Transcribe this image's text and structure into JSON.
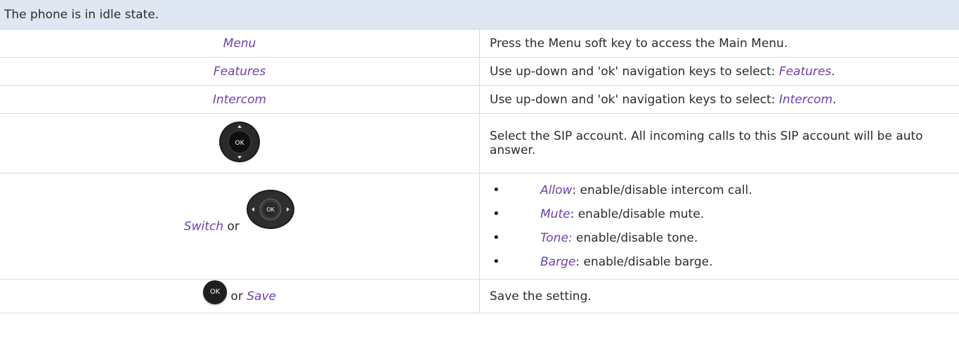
{
  "header": {
    "text": "The phone is in idle state."
  },
  "rows": [
    {
      "left": "Menu",
      "right": "Press the Menu soft key to access the Main Menu."
    },
    {
      "left": "Features",
      "right_prefix": "Use up-down and 'ok' navigation keys to select: ",
      "right_em": "Features",
      "right_suffix": "."
    },
    {
      "left": "Intercom",
      "right_prefix": "Use up-down and 'ok' navigation keys to select: ",
      "right_em": "Intercom",
      "right_suffix": "."
    },
    {
      "left_icon": "navigation-ok-pad-icon",
      "left_label": "OK",
      "right": "Select the SIP account. All incoming calls to this SIP account will be auto answer."
    },
    {
      "left_em": "Switch",
      "left_or": " or",
      "left_icon": "navigation-left-right-pad-icon",
      "left_label": "OK",
      "bullets": [
        {
          "em": "Allow",
          "text": ": enable/disable intercom call."
        },
        {
          "em": "Mute",
          "text": ": enable/disable mute."
        },
        {
          "em": "Tone:",
          "text": " enable/disable tone."
        },
        {
          "em": "Barge",
          "text": ": enable/disable barge."
        }
      ]
    },
    {
      "left_icon": "ok-key-icon",
      "left_label": "OK",
      "left_or": " or ",
      "left_em": "Save",
      "right": "Save the setting."
    }
  ],
  "colors": {
    "header_bg": "#dfe7f2",
    "accent_text": "#6d3fb0",
    "border": "#d6dbe3"
  }
}
